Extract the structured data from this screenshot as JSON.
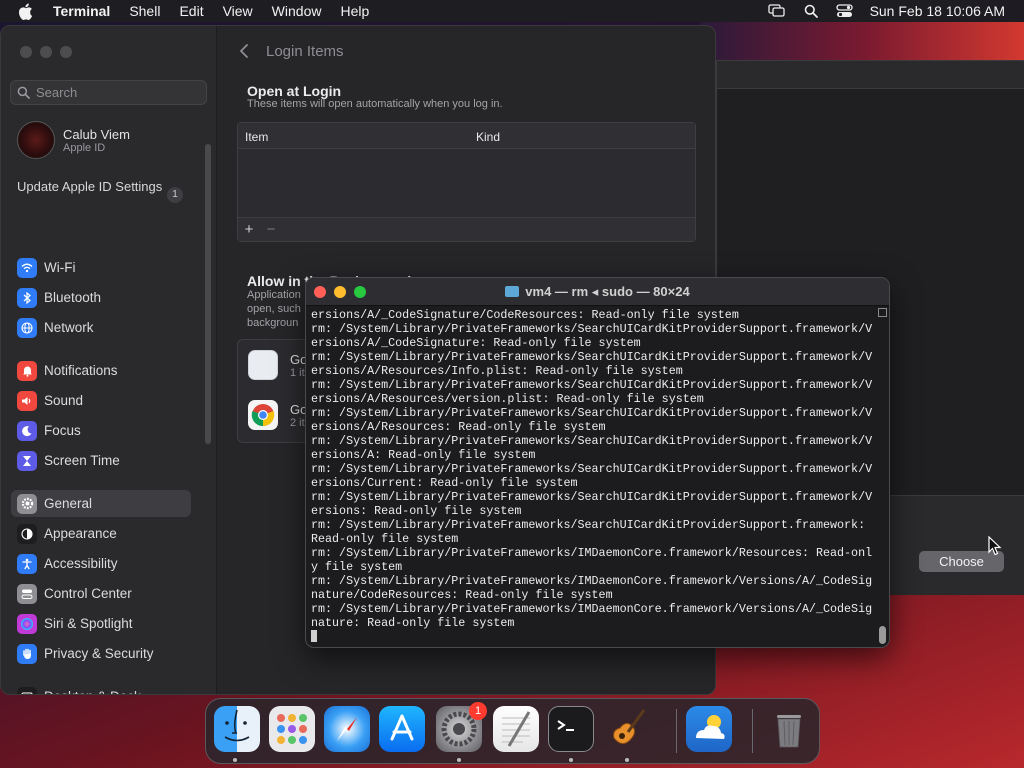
{
  "menubar": {
    "app_name": "Terminal",
    "items": [
      "Shell",
      "Edit",
      "View",
      "Window",
      "Help"
    ],
    "clock": "Sun Feb 18  10:06 AM"
  },
  "settings": {
    "search_placeholder": "Search",
    "account": {
      "name": "Calub Viem",
      "sub": "Apple ID"
    },
    "update": {
      "label": "Update Apple ID Settings",
      "badge": "1"
    },
    "sidebar": [
      {
        "label": "Wi-Fi",
        "icon": "wifi-icon",
        "color": "#2f7cf6"
      },
      {
        "label": "Bluetooth",
        "icon": "bluetooth-icon",
        "color": "#2f7cf6"
      },
      {
        "label": "Network",
        "icon": "globe-icon",
        "color": "#2f7cf6"
      },
      {
        "label": "Notifications",
        "icon": "bell-icon",
        "color": "#f0483e"
      },
      {
        "label": "Sound",
        "icon": "speaker-icon",
        "color": "#f0483e"
      },
      {
        "label": "Focus",
        "icon": "moon-icon",
        "color": "#5e5ce6"
      },
      {
        "label": "Screen Time",
        "icon": "hourglass-icon",
        "color": "#5e5ce6"
      },
      {
        "label": "General",
        "icon": "gear-icon",
        "color": "#8e8e93"
      },
      {
        "label": "Appearance",
        "icon": "appearance-icon",
        "color": "#1d1d1f"
      },
      {
        "label": "Accessibility",
        "icon": "accessibility-icon",
        "color": "#2f7cf6"
      },
      {
        "label": "Control Center",
        "icon": "control-center-icon",
        "color": "#8e8e93"
      },
      {
        "label": "Siri & Spotlight",
        "icon": "siri-icon",
        "color": "#c03ad8"
      },
      {
        "label": "Privacy & Security",
        "icon": "hand-icon",
        "color": "#2f7cf6"
      },
      {
        "label": "Desktop & Dock",
        "icon": "dock-icon",
        "color": "#1d1d1f"
      }
    ],
    "content": {
      "title": "Login Items",
      "open_title": "Open at Login",
      "open_sub": "These items will open automatically when you log in.",
      "columns": [
        "Item",
        "Kind"
      ],
      "add": "+",
      "remove": "−",
      "allow_title": "Allow in the Background",
      "allow_sub_lines": [
        "Application",
        "open, such",
        "backgroun"
      ],
      "bg_items": [
        {
          "title": "Go",
          "sub": "1 it"
        },
        {
          "title": "Go",
          "sub": "2 it"
        }
      ]
    }
  },
  "dialog": {
    "choose": "Choose"
  },
  "terminal": {
    "title": "vm4 — rm ◂ sudo — 80×24",
    "lines": [
      "ersions/A/_CodeSignature/CodeResources: Read-only file system",
      "rm: /System/Library/PrivateFrameworks/SearchUICardKitProviderSupport.framework/V",
      "ersions/A/_CodeSignature: Read-only file system",
      "rm: /System/Library/PrivateFrameworks/SearchUICardKitProviderSupport.framework/V",
      "ersions/A/Resources/Info.plist: Read-only file system",
      "rm: /System/Library/PrivateFrameworks/SearchUICardKitProviderSupport.framework/V",
      "ersions/A/Resources/version.plist: Read-only file system",
      "rm: /System/Library/PrivateFrameworks/SearchUICardKitProviderSupport.framework/V",
      "ersions/A/Resources: Read-only file system",
      "rm: /System/Library/PrivateFrameworks/SearchUICardKitProviderSupport.framework/V",
      "ersions/A: Read-only file system",
      "rm: /System/Library/PrivateFrameworks/SearchUICardKitProviderSupport.framework/V",
      "ersions/Current: Read-only file system",
      "rm: /System/Library/PrivateFrameworks/SearchUICardKitProviderSupport.framework/V",
      "ersions: Read-only file system",
      "rm: /System/Library/PrivateFrameworks/SearchUICardKitProviderSupport.framework:",
      "Read-only file system",
      "rm: /System/Library/PrivateFrameworks/IMDaemonCore.framework/Resources: Read-onl",
      "y file system",
      "rm: /System/Library/PrivateFrameworks/IMDaemonCore.framework/Versions/A/_CodeSig",
      "nature/CodeResources: Read-only file system",
      "rm: /System/Library/PrivateFrameworks/IMDaemonCore.framework/Versions/A/_CodeSig",
      "nature: Read-only file system"
    ]
  },
  "dock": {
    "items": [
      {
        "name": "finder",
        "running": true
      },
      {
        "name": "launchpad",
        "running": false
      },
      {
        "name": "safari",
        "running": false
      },
      {
        "name": "app-store",
        "running": false
      },
      {
        "name": "system-settings",
        "running": true,
        "badge": "1"
      },
      {
        "name": "textedit",
        "running": false
      },
      {
        "name": "terminal",
        "running": true
      },
      {
        "name": "garageband",
        "running": true
      },
      {
        "name": "weather",
        "running": false
      },
      {
        "name": "trash",
        "running": false
      }
    ]
  }
}
